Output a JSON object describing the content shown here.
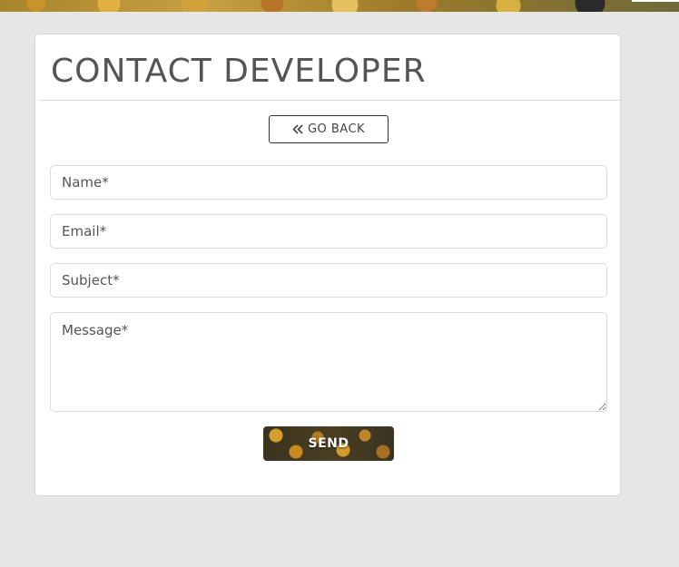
{
  "page": {
    "title": "CONTACT DEVELOPER"
  },
  "nav": {
    "back_label": "GO BACK",
    "back_icon": "double-chevron-left-icon"
  },
  "form": {
    "name_placeholder": "Name*",
    "email_placeholder": "Email*",
    "subject_placeholder": "Subject*",
    "message_placeholder": "Message*",
    "send_label": "SEND"
  },
  "colors": {
    "background": "#e6e6e6",
    "card": "#ffffff",
    "title_text": "#555555",
    "button_border": "#333333"
  }
}
